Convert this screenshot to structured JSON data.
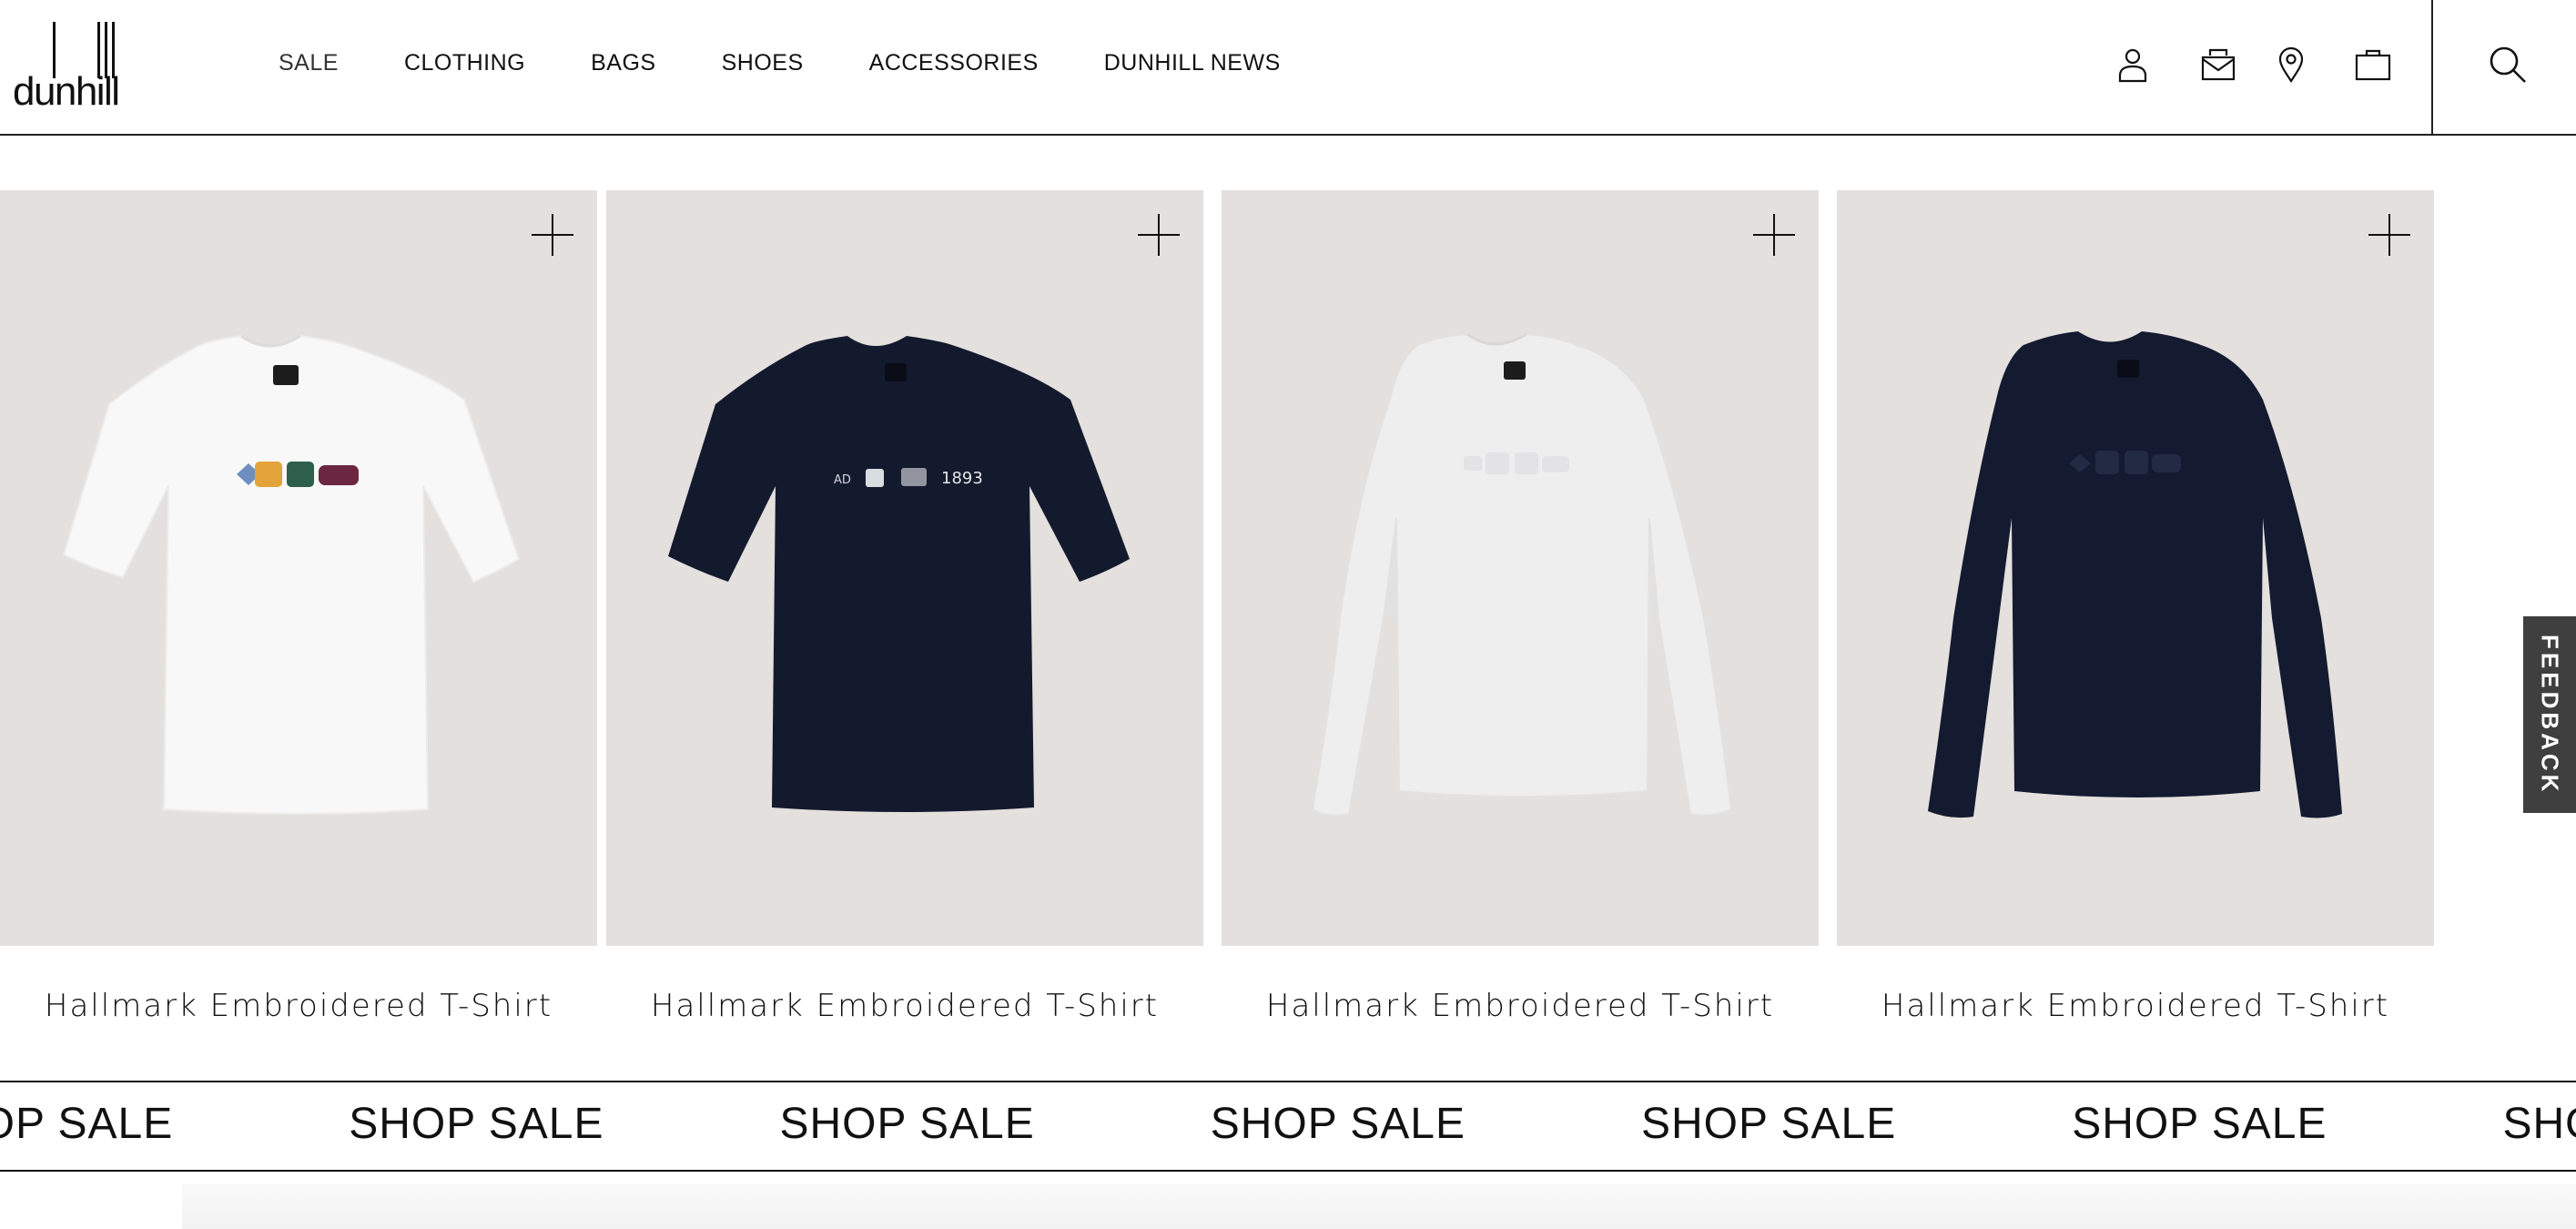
{
  "header": {
    "logo_text": "dunhill",
    "nav": [
      {
        "label": "SALE"
      },
      {
        "label": "CLOTHING"
      },
      {
        "label": "BAGS"
      },
      {
        "label": "SHOES"
      },
      {
        "label": "ACCESSORIES"
      },
      {
        "label": "DUNHILL NEWS"
      }
    ],
    "icons": [
      "account-icon",
      "contact-mail-icon",
      "store-locator-icon",
      "shopping-bag-icon",
      "search-icon"
    ]
  },
  "products": [
    {
      "title": "Hallmark Embroidered T-Shirt",
      "shirt_color": "#f8f8f8",
      "sleeve": "short",
      "print_text": ""
    },
    {
      "title": "Hallmark Embroidered T-Shirt",
      "shirt_color": "#141a2e",
      "sleeve": "short",
      "print_text": "1893"
    },
    {
      "title": "Hallmark Embroidered T-Shirt",
      "shirt_color": "#eeeeef",
      "sleeve": "long",
      "print_text": ""
    },
    {
      "title": "Hallmark Embroidered T-Shirt",
      "shirt_color": "#141a30",
      "sleeve": "long",
      "print_text": ""
    }
  ],
  "marquee": {
    "items": [
      "SHOP SALE",
      "SHOP SALE",
      "SHOP SALE",
      "SHOP SALE",
      "SHOP SALE",
      "SHOP SALE",
      "SHOP SALE"
    ]
  },
  "feedback": {
    "label": "FEEDBACK"
  },
  "colors": {
    "image_bg": "#e3e0dd",
    "text": "#111111",
    "feedback_bg": "#3f3f3f"
  }
}
